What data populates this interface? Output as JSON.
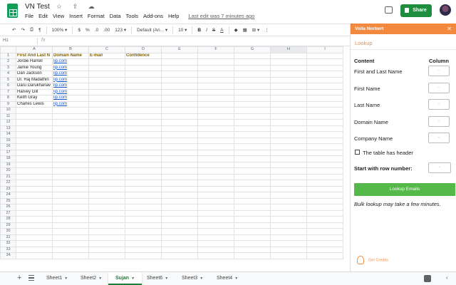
{
  "app": {
    "doc_title": "VN Test",
    "title_icons": "☆ ⇪ ☁",
    "menu": [
      "File",
      "Edit",
      "View",
      "Insert",
      "Format",
      "Data",
      "Tools",
      "Add-ons",
      "Help"
    ],
    "last_edit": "Last edit was 7 minutes ago",
    "share_label": "Share"
  },
  "toolbar": {
    "undo": "↶",
    "redo": "↷",
    "print": "⎙",
    "paint": "¶",
    "zoom": "100% ▾",
    "currency": "$",
    "percent": "%",
    "dec_dec": ".0",
    "dec_inc": ".00",
    "more_formats": "123 ▾",
    "font": "Default (Ari... ▾",
    "font_size": "10 ▾",
    "bold": "B",
    "italic": "I",
    "strike": "S",
    "text_color": "A",
    "fill": "◆",
    "borders": "▦",
    "merge": "⊞ ▾",
    "more": "⋮"
  },
  "formula_bar": {
    "cell_ref": "H1",
    "fx": "fx",
    "value": ""
  },
  "grid": {
    "columns": [
      "A",
      "B",
      "C",
      "D",
      "E",
      "F",
      "G",
      "H",
      "I"
    ],
    "selected_column": "H",
    "row_count": 34,
    "rows": [
      [
        "First And Last N",
        "Domain Name",
        "E-mail",
        "Confidence",
        "",
        "",
        "",
        "",
        ""
      ],
      [
        "Jordie Harrell",
        "lip.com",
        "",
        "",
        "",
        "",
        "",
        "",
        ""
      ],
      [
        "Jamie Young",
        "lip.com",
        "",
        "",
        "",
        "",
        "",
        "",
        ""
      ],
      [
        "Dan Jackson",
        "lip.com",
        "",
        "",
        "",
        "",
        "",
        "",
        ""
      ],
      [
        "Dr. Raj Madathin",
        "lip.com",
        "",
        "",
        "",
        "",
        "",
        "",
        ""
      ],
      [
        "Daru Darukhanav",
        "lip.com",
        "",
        "",
        "",
        "",
        "",
        "",
        ""
      ],
      [
        "Harvey Gill",
        "lip.com",
        "",
        "",
        "",
        "",
        "",
        "",
        ""
      ],
      [
        "Keith Gray",
        "lip.com",
        "",
        "",
        "",
        "",
        "",
        "",
        ""
      ],
      [
        "Charles Lewis",
        "lip.com",
        "",
        "",
        "",
        "",
        "",
        "",
        ""
      ]
    ]
  },
  "sheet_tabs": {
    "add": "+",
    "tabs": [
      {
        "label": "Sheet1",
        "active": false
      },
      {
        "label": "Sheet2",
        "active": false
      },
      {
        "label": "Sujan",
        "active": true
      },
      {
        "label": "Sheet6",
        "active": false
      },
      {
        "label": "Sheet3",
        "active": false
      },
      {
        "label": "Sheet4",
        "active": false
      }
    ],
    "collapse": "‹"
  },
  "panel": {
    "title": "Voila Norbert",
    "close": "✕",
    "tab": "Lookup",
    "content_header": "Content",
    "column_header": "Column",
    "fields": [
      {
        "label": "First and Last Name",
        "value": "-"
      },
      {
        "label": "First Name",
        "value": "-"
      },
      {
        "label": "Last Name",
        "value": "-"
      },
      {
        "label": "Domain Name",
        "value": "-"
      },
      {
        "label": "Company Name",
        "value": "-"
      }
    ],
    "header_checkbox_label": "The table has header",
    "header_checked": false,
    "start_row_label": "Start with row number:",
    "start_row_value": "-",
    "lookup_button": "Lookup Emails",
    "note": "Bulk lookup may take a few minutes.",
    "credits": "Get Credits",
    "accent_color": "#f2893e",
    "button_color": "#54b948"
  }
}
